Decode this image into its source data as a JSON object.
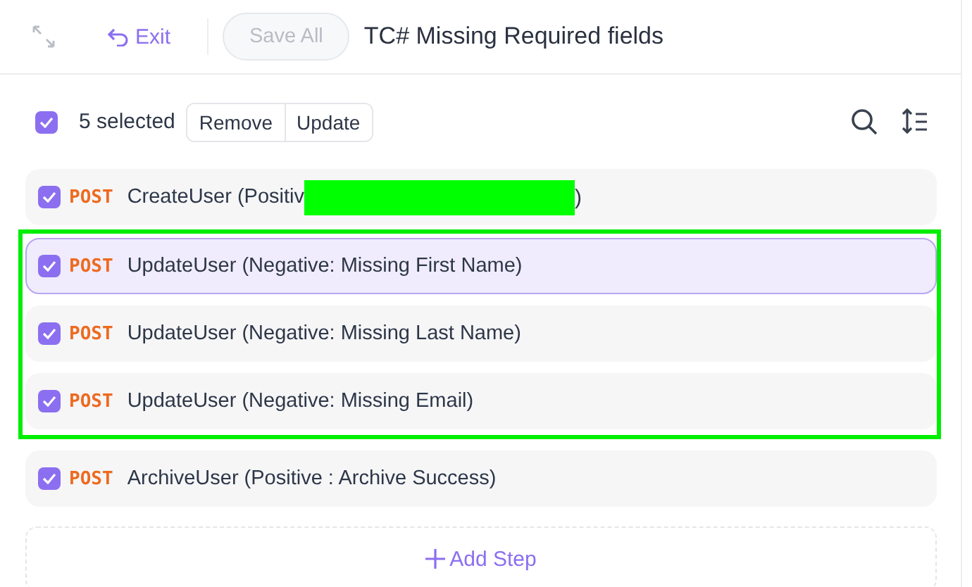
{
  "header": {
    "exit_label": "Exit",
    "save_label": "Save All",
    "save_disabled": true,
    "title": "TC# Missing Required fields"
  },
  "selection": {
    "checked": true,
    "count_label": "5 selected",
    "actions": [
      "Remove",
      "Update"
    ]
  },
  "steps": [
    {
      "method": "POST",
      "name": "CreateUser (Positiv",
      "redacted": true,
      "name_tail": ")",
      "checked": true,
      "selected": false,
      "highlighted": false
    },
    {
      "method": "POST",
      "name": "UpdateUser (Negative: Missing First Name)",
      "redacted": false,
      "checked": true,
      "selected": true,
      "highlighted": true
    },
    {
      "method": "POST",
      "name": "UpdateUser (Negative: Missing Last Name)",
      "redacted": false,
      "checked": true,
      "selected": false,
      "highlighted": true
    },
    {
      "method": "POST",
      "name": "UpdateUser (Negative: Missing Email)",
      "redacted": false,
      "checked": true,
      "selected": false,
      "highlighted": true
    },
    {
      "method": "POST",
      "name": "ArchiveUser (Positive : Archive Success)",
      "redacted": false,
      "checked": true,
      "selected": false,
      "highlighted": false
    }
  ],
  "add_step_label": "Add Step"
}
